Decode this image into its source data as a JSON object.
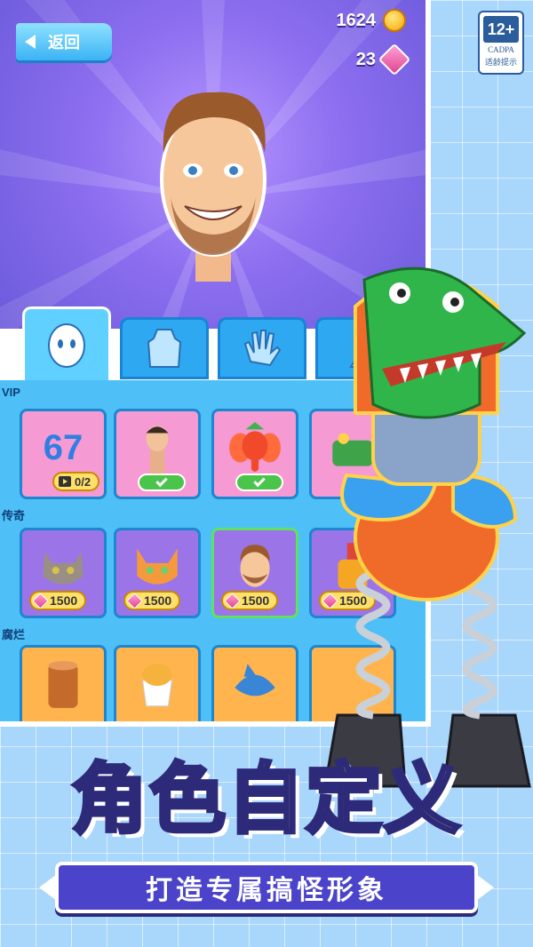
{
  "header": {
    "back_label": "返回",
    "coins": "1624",
    "gems": "23"
  },
  "tabs": [
    {
      "icon": "face-icon",
      "active": true
    },
    {
      "icon": "torso-icon",
      "active": false
    },
    {
      "icon": "hand-icon",
      "active": false
    },
    {
      "icon": "leg-icon",
      "active": false
    }
  ],
  "sections": [
    {
      "label": "VIP",
      "items": [
        {
          "name": "67-character",
          "icon_text": "67",
          "bg": "pink",
          "status": "video",
          "progress": "0/2"
        },
        {
          "name": "tall-head-man",
          "icon_text": "",
          "bg": "pink",
          "status": "owned"
        },
        {
          "name": "elephant-strawberry",
          "icon_text": "",
          "bg": "pink",
          "status": "owned"
        },
        {
          "name": "crocodile",
          "icon_text": "",
          "bg": "pink",
          "status": "none"
        }
      ]
    },
    {
      "label": "传奇",
      "items": [
        {
          "name": "grey-cat",
          "icon_text": "",
          "bg": "purple",
          "status": "price",
          "price": "1500"
        },
        {
          "name": "orange-cat",
          "icon_text": "",
          "bg": "purple",
          "status": "price",
          "price": "1500"
        },
        {
          "name": "bearded-man",
          "icon_text": "",
          "bg": "purple",
          "status": "price",
          "price": "1500",
          "selected": true
        },
        {
          "name": "hot-sauce",
          "icon_text": "",
          "bg": "purple",
          "status": "price",
          "price": "1500"
        }
      ]
    },
    {
      "label": "腐烂",
      "items": [
        {
          "name": "log",
          "icon_text": "",
          "bg": "orange",
          "status": "none"
        },
        {
          "name": "cappuccino",
          "icon_text": "",
          "bg": "orange",
          "status": "none"
        },
        {
          "name": "shark",
          "icon_text": "",
          "bg": "orange",
          "status": "none"
        },
        {
          "name": "other",
          "icon_text": "",
          "bg": "orange",
          "status": "none"
        }
      ]
    }
  ],
  "age_rating": {
    "number": "12+",
    "org": "CADPA",
    "tip": "适龄提示"
  },
  "title": {
    "part_a": "角色",
    "part_b": "自定义"
  },
  "subtitle": "打造专属搞怪形象",
  "colors": {
    "hero_bg": "#8d6ff0",
    "grid_bg": "#4ec0f7",
    "accent_green": "#4bc44b",
    "title_purple": "#9a86ff",
    "title_yellow": "#ffd24a",
    "subtitle_bg": "#4b43c9"
  }
}
